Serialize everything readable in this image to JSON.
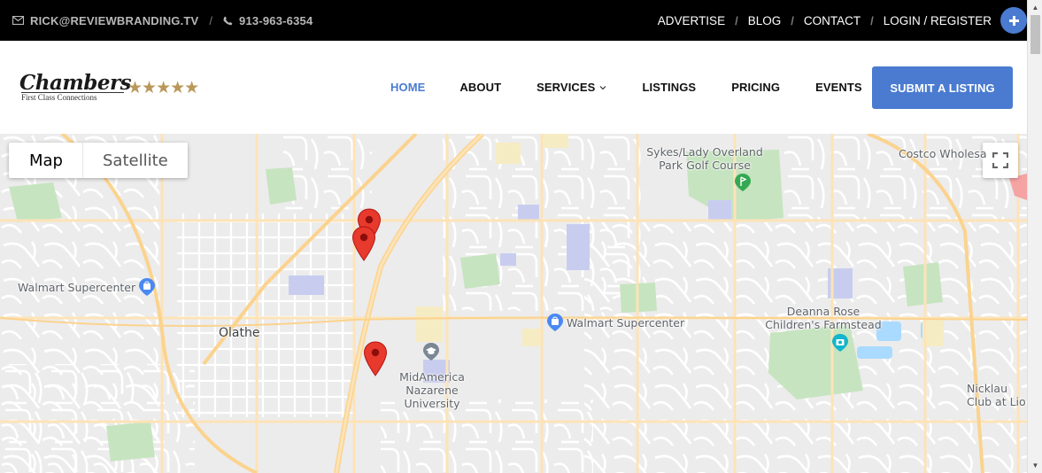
{
  "topbar": {
    "email": "RICK@REVIEWBRANDING.TV",
    "phone": "913-963-6354",
    "links": [
      {
        "label": "ADVERTISE"
      },
      {
        "label": "BLOG"
      },
      {
        "label": "CONTACT"
      },
      {
        "label": "LOGIN / REGISTER"
      }
    ],
    "icons": {
      "email": "envelope-icon",
      "phone": "phone-icon",
      "plus": "plus-icon"
    }
  },
  "header": {
    "logo": {
      "script": "Chambers",
      "tagline": "First Class Connections",
      "stars": "★★★★★"
    },
    "nav": [
      {
        "label": "HOME",
        "active": true
      },
      {
        "label": "ABOUT"
      },
      {
        "label": "SERVICES",
        "has_dropdown": true
      },
      {
        "label": "LISTINGS"
      },
      {
        "label": "PRICING"
      },
      {
        "label": "EVENTS"
      }
    ],
    "submit_label": "SUBMIT A LISTING",
    "accent_color": "#4a7bd0"
  },
  "map": {
    "type_controls": [
      {
        "label": "Map",
        "selected": true
      },
      {
        "label": "Satellite",
        "selected": false
      }
    ],
    "labels": {
      "walmart_west": "Walmart Supercenter",
      "olathe": "Olathe",
      "walmart_center": "Walmart Supercenter",
      "golf_line1": "Sykes/Lady Overland",
      "golf_line2": "Park Golf Course",
      "costco": "Costco Wholesa",
      "deanna_line1": "Deanna Rose",
      "deanna_line2": "Children's Farmstead",
      "mna_line1": "MidAmerica",
      "mna_line2": "Nazarene",
      "mna_line3": "University",
      "nicklaus_line1": "Nicklau",
      "nicklaus_line2": "Club at Lio"
    },
    "markers": [
      {
        "name": "marker-1"
      },
      {
        "name": "marker-2"
      },
      {
        "name": "marker-3"
      }
    ],
    "colors": {
      "land": "#ececec",
      "road": "#ffffff",
      "arterial": "#fde3b7",
      "park": "#c6e4c0",
      "water": "#aadaff",
      "commercial": "#c8cdf0",
      "marker": "#e8392d"
    }
  }
}
